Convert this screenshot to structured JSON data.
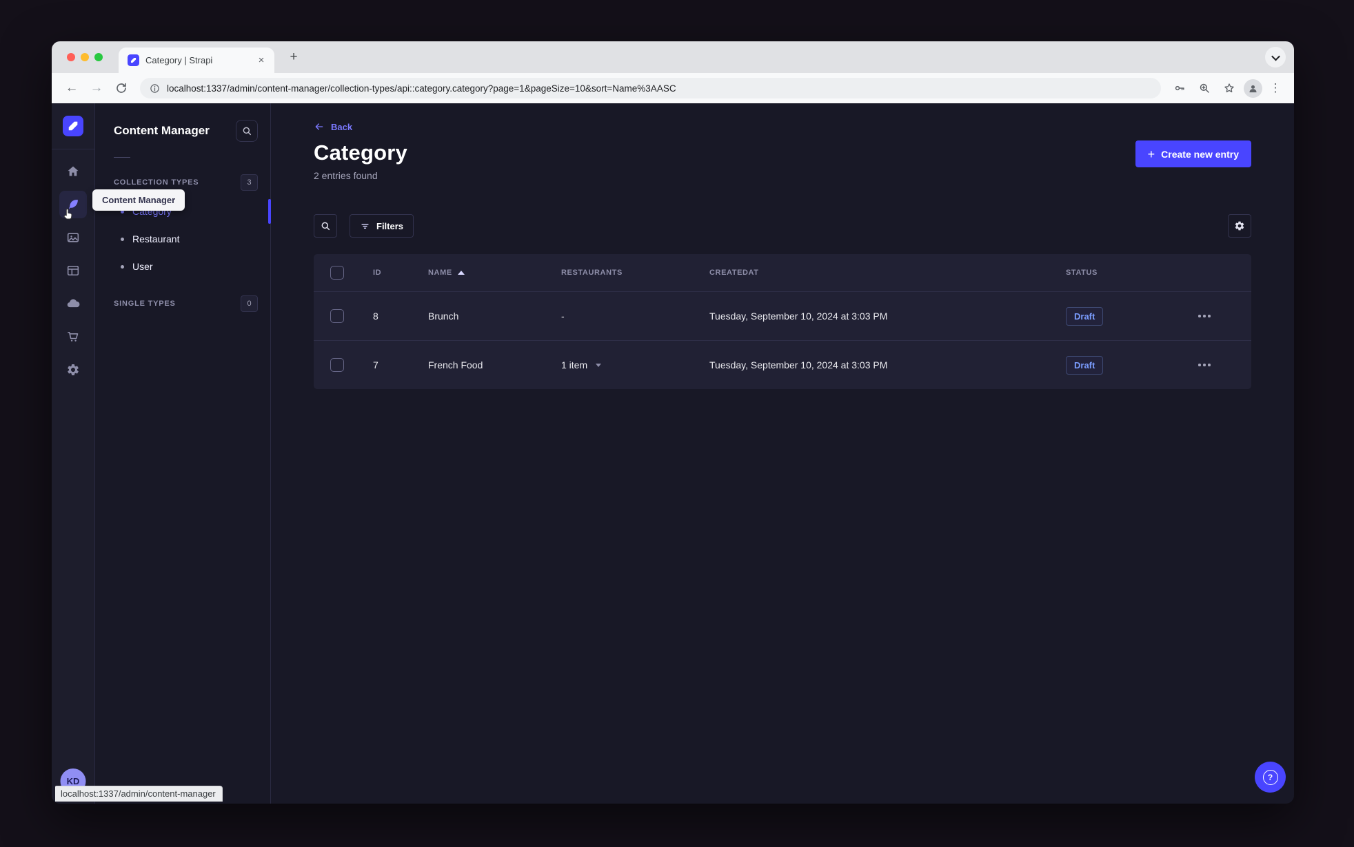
{
  "browser": {
    "tab_title": "Category | Strapi",
    "url": "localhost:1337/admin/content-manager/collection-types/api::category.category?page=1&pageSize=10&sort=Name%3AASC",
    "glyphs": {
      "back": "←",
      "forward": "→",
      "new_tab": "+",
      "close_tab": "×",
      "menu": "⋮"
    }
  },
  "sidebar": {
    "avatar_initials": "KD"
  },
  "nav": {
    "title": "Content Manager",
    "sections": {
      "collection": {
        "label": "COLLECTION TYPES",
        "count": "3"
      },
      "single": {
        "label": "SINGLE TYPES",
        "count": "0"
      }
    },
    "items": [
      {
        "label": "Category"
      },
      {
        "label": "Restaurant"
      },
      {
        "label": "User"
      }
    ]
  },
  "tooltip_text": "Content Manager",
  "statusbar_text": "localhost:1337/admin/content-manager",
  "main": {
    "back_label": "Back",
    "title": "Category",
    "subtitle": "2 entries found",
    "create_label": "Create new entry",
    "filters_label": "Filters",
    "help_glyph": "?"
  },
  "table": {
    "headers": {
      "id": "ID",
      "name": "NAME",
      "restaurants": "RESTAURANTS",
      "createdat": "CREATEDAT",
      "status": "STATUS"
    },
    "rows": [
      {
        "id": "8",
        "name": "Brunch",
        "restaurants": "-",
        "createdat": "Tuesday, September 10, 2024 at 3:03 PM",
        "status": "Draft"
      },
      {
        "id": "7",
        "name": "French Food",
        "restaurants": "1 item",
        "createdat": "Tuesday, September 10, 2024 at 3:03 PM",
        "status": "Draft"
      }
    ]
  },
  "colors": {
    "accent": "#4945FF",
    "accent_light": "#7B79FF",
    "draft_text": "#7B9DFF",
    "surface": "#212134",
    "background": "#181826"
  }
}
